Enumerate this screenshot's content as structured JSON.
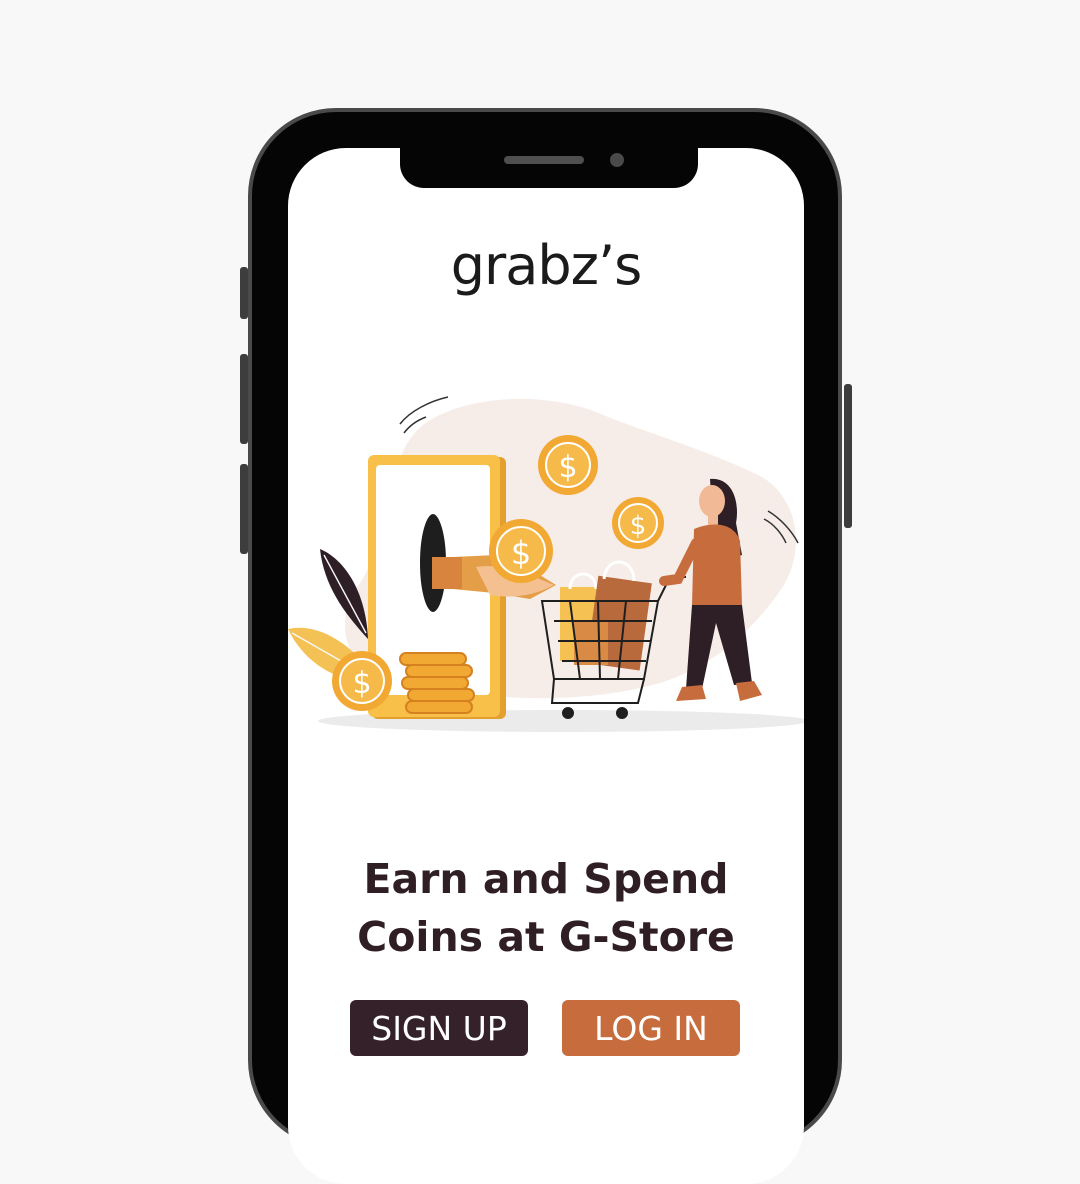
{
  "app": {
    "logo_text": "grabz’s"
  },
  "content": {
    "headline_line1": "Earn and Spend",
    "headline_line2": "Coins at G-Store"
  },
  "buttons": {
    "signup_label": "SIGN UP",
    "login_label": "LOG IN"
  },
  "colors": {
    "headline": "#2f1f25",
    "signup_bg": "#35212a",
    "login_bg": "#c76d3d",
    "coin": "#f2a933",
    "phone_frame": "#050505"
  },
  "illustration": {
    "icons": [
      "smartphone-icon",
      "coin-icon",
      "hand-icon",
      "shopping-cart-icon",
      "shopping-bag-icon",
      "woman-shopper-icon",
      "leaf-icon"
    ]
  }
}
